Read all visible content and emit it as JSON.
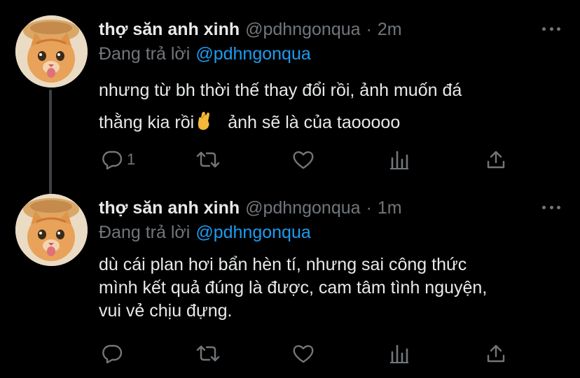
{
  "tweets": [
    {
      "name": "thợ săn anh xinh",
      "handle": "@pdhngonqua",
      "separator": "·",
      "time": "2m",
      "replying_label": "Đang trả lời",
      "replying_to": "@pdhngonqua",
      "text_line1": "nhưng từ bh thời thế thay đổi rồi, ảnh muốn đá",
      "text_line2a": "thằng kia rồi",
      "emoji": "crossed-fingers",
      "text_line2b": "ảnh sẽ là của taooooo",
      "reply_count": "1"
    },
    {
      "name": "thợ săn anh xinh",
      "handle": "@pdhngonqua",
      "separator": "·",
      "time": "1m",
      "replying_label": "Đang trả lời",
      "replying_to": "@pdhngonqua",
      "text_line1": "dù cái plan hơi bẩn hèn tí, nhưng sai công thức",
      "text_line2": "mình kết quả đúng là được, cam tâm tình nguyện,",
      "text_line3": "vui vẻ chịu đựng.",
      "reply_count": ""
    }
  ],
  "icons": [
    "reply-icon",
    "retweet-icon",
    "like-icon",
    "analytics-icon",
    "share-icon",
    "more-icon"
  ],
  "colors": {
    "background": "#000000",
    "text": "#e7e9ea",
    "muted": "#71767b",
    "accent": "#1d9bf0",
    "thread_line": "#3e4144"
  }
}
